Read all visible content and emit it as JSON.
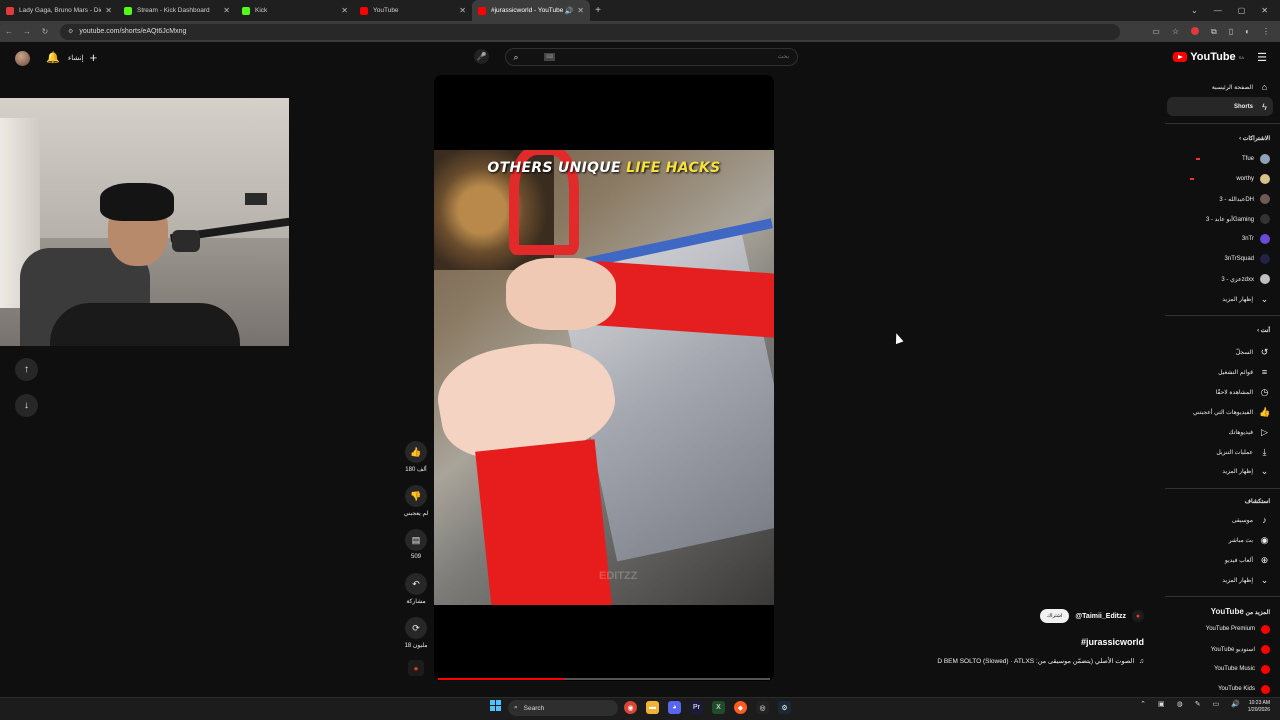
{
  "browser": {
    "tabs": [
      {
        "label": "Lady Gaga, Bruno Mars - Die W",
        "favicon_color": "#e33b3b"
      },
      {
        "label": "Stream - Kick Dashboard",
        "favicon_color": "#53fc18"
      },
      {
        "label": "Kick",
        "favicon_color": "#53fc18"
      },
      {
        "label": "YouTube",
        "favicon_color": "#ff0000"
      },
      {
        "label": "#jurassicworld - YouTube",
        "favicon_color": "#ff0000",
        "active": true
      }
    ],
    "url": "youtube.com/shorts/eAQt6JcMxng"
  },
  "header": {
    "create_label": "إنشاء",
    "search_placeholder": "بحث",
    "search_kbd": "⌨",
    "logo_text": "YouTube",
    "logo_region": "SA"
  },
  "short": {
    "overlay_title": "OTHERS UNIQUE",
    "overlay_highlight": "LIFE HACKS",
    "watermark": "EDITZZ",
    "progress": 0.38
  },
  "actions": {
    "likes": "180 ألف",
    "dislike_label": "لم يعجبني",
    "comments": "509",
    "share_label": "مشاركة",
    "remix_label": "18 مليون"
  },
  "info": {
    "subscribe_label": "اشتراك",
    "channel": "@Taimii_Editzz",
    "hashtag": "#jurassicworld",
    "audio": "D BEM SOLTO (Slowed) · ATLXS :الصوت الأصلي (يتضمّن موسيقى من"
  },
  "sidebar": {
    "home": "الصفحة الرئيسية",
    "shorts": "Shorts",
    "subs_header": "الاشتراكات",
    "subs": [
      {
        "name": "Tfue",
        "color": "#8fa3b8",
        "live": true
      },
      {
        "name": "worthy",
        "color": "#d9c28a",
        "live": true
      },
      {
        "name": "عبدالله - 3DH",
        "color": "#6e5a52",
        "live": false
      },
      {
        "name": "أبو عابد - 3Gaming",
        "color": "#333333",
        "live": false
      },
      {
        "name": "3nTr",
        "color": "#6b4ad9",
        "live": false
      },
      {
        "name": "3nTrSquad",
        "color": "#222244",
        "live": false
      },
      {
        "name": "عزي - 3zdxx",
        "color": "#c0c0c0",
        "live": false
      }
    ],
    "show_more_subs": "إظهار المزيد",
    "you_header": "أنت",
    "you_items": [
      {
        "label": "السجلّ",
        "icon": "history-icon",
        "glyph": "↺"
      },
      {
        "label": "قوائم التشغيل",
        "icon": "playlist-icon",
        "glyph": "≡"
      },
      {
        "label": "المشاهدة لاحقًا",
        "icon": "clock-icon",
        "glyph": "◷"
      },
      {
        "label": "الفيديوهات التي أعجبتني",
        "icon": "like-icon",
        "glyph": "👍"
      },
      {
        "label": "فيديوهاتك",
        "icon": "your-videos-icon",
        "glyph": "▷"
      },
      {
        "label": "عمليات التنزيل",
        "icon": "download-icon",
        "glyph": "⤓"
      }
    ],
    "show_more_you": "إظهار المزيد",
    "explore_header": "استكشاف",
    "explore_items": [
      {
        "label": "موسيقى",
        "icon": "music-icon",
        "glyph": "♪"
      },
      {
        "label": "بث مباشر",
        "icon": "live-icon",
        "glyph": "◉"
      },
      {
        "label": "ألعاب فيديو",
        "icon": "gaming-icon",
        "glyph": "⊕"
      }
    ],
    "show_more_explore": "إظهار المزيد",
    "more_header_prefix": "المزيد من",
    "more_header_brand": "YouTube",
    "more_items": [
      {
        "label": "YouTube Premium",
        "color": "#ff0000"
      },
      {
        "label": "YouTube استوديو",
        "color": "#ff0000"
      },
      {
        "label": "YouTube Music",
        "color": "#ff0000"
      },
      {
        "label": "YouTube Kids",
        "color": "#ff0000"
      }
    ]
  },
  "taskbar": {
    "search_label": "Search",
    "time": "10:23 AM",
    "date": "1/20/2026"
  }
}
